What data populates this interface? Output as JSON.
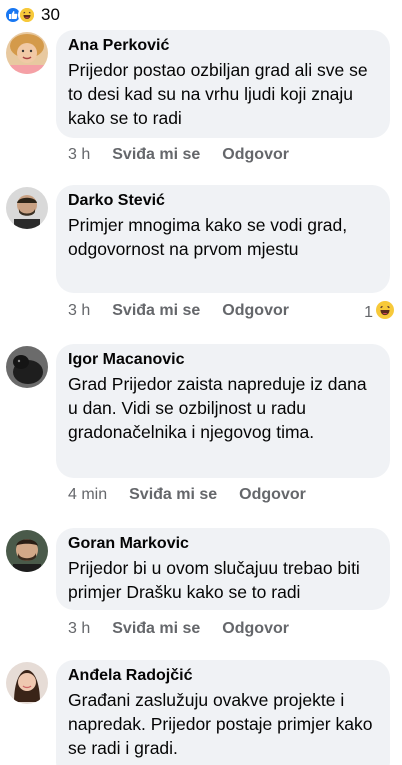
{
  "header": {
    "reaction_count": "30",
    "reactions": [
      "like-icon",
      "haha-icon"
    ]
  },
  "comments": [
    {
      "name": "Ana Perković",
      "text": "Prijedor postao ozbiljan grad ali sve se to desi kad su na vrhu ljudi koji znaju kako se to radi",
      "time": "3 h",
      "like": "Sviđa mi se",
      "reply": "Odgovor"
    },
    {
      "name": "Darko Stević",
      "text": "Primjer mnogima kako se vodi grad, odgovornost na prvom mjestu",
      "time": "3 h",
      "like": "Sviđa mi se",
      "reply": "Odgovor",
      "reaction_count": "1"
    },
    {
      "name": "Igor Macanovic",
      "text": "Grad Prijedor zaista napreduje iz dana u dan. Vidi se ozbiljnost u radu gradonačelnika i njegovog tima.",
      "time": "4 min",
      "like": "Sviđa mi se",
      "reply": "Odgovor"
    },
    {
      "name": "Goran Markovic",
      "text": "Prijedor bi u ovom slučajuu trebao biti primjer Drašku kako se to radi",
      "time": "3 h",
      "like": "Sviđa mi se",
      "reply": "Odgovor"
    },
    {
      "name": "Anđela Radojčić",
      "text": "Građani zaslužuju ovakve projekte i napredak. Prijedor postaje primjer kako se radi i gradi.",
      "time": "",
      "like": "",
      "reply": ""
    }
  ],
  "colors": {
    "bubble": "#f0f2f5",
    "meta": "#65676b",
    "like_blue": "#1877f2",
    "haha_yellow": "#f7c93a"
  }
}
